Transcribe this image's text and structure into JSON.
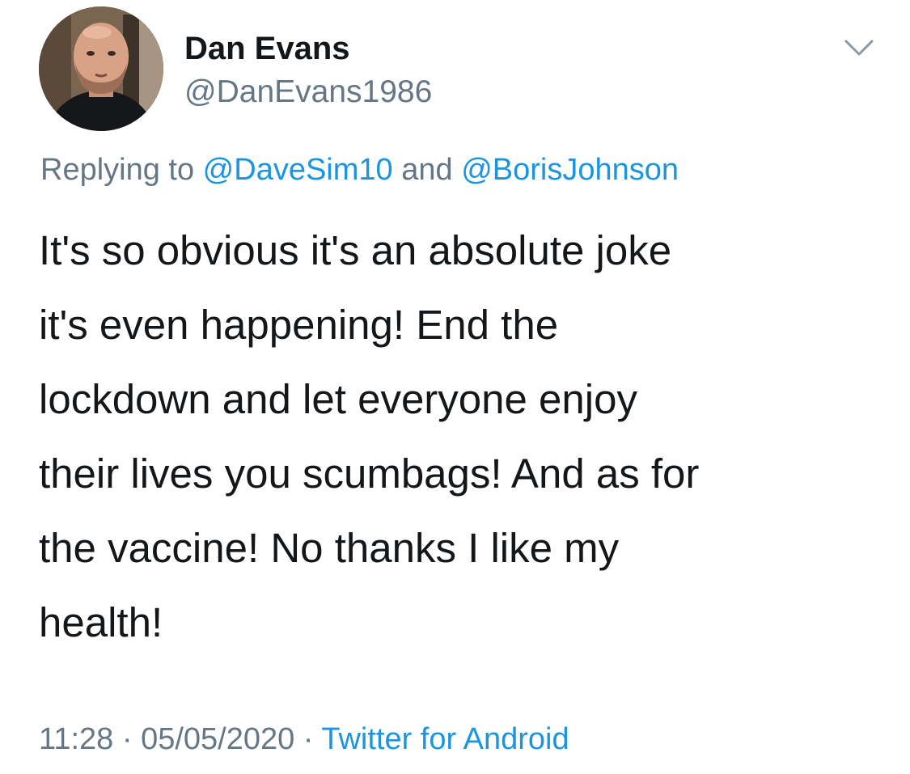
{
  "author": {
    "display_name": "Dan Evans",
    "handle": "@DanEvans1986",
    "avatar_icon": "profile-photo"
  },
  "menu": {
    "icon": "chevron-down-icon"
  },
  "reply_context": {
    "prefix": "Replying to ",
    "mentions": [
      "@DaveSim10",
      "@BorisJohnson"
    ],
    "joiner": " and "
  },
  "tweet": {
    "text": "It's so obvious it's an absolute joke\nit's even happening! End the\nlockdown and let everyone enjoy\ntheir lives you scumbags! And as for\nthe vaccine! No thanks I like my\nhealth!"
  },
  "meta": {
    "time": "11:28",
    "separator": " · ",
    "date": "05/05/2020",
    "source": "Twitter for Android"
  },
  "colors": {
    "text": "#14171a",
    "secondary": "#657786",
    "link": "#1b95e0"
  }
}
